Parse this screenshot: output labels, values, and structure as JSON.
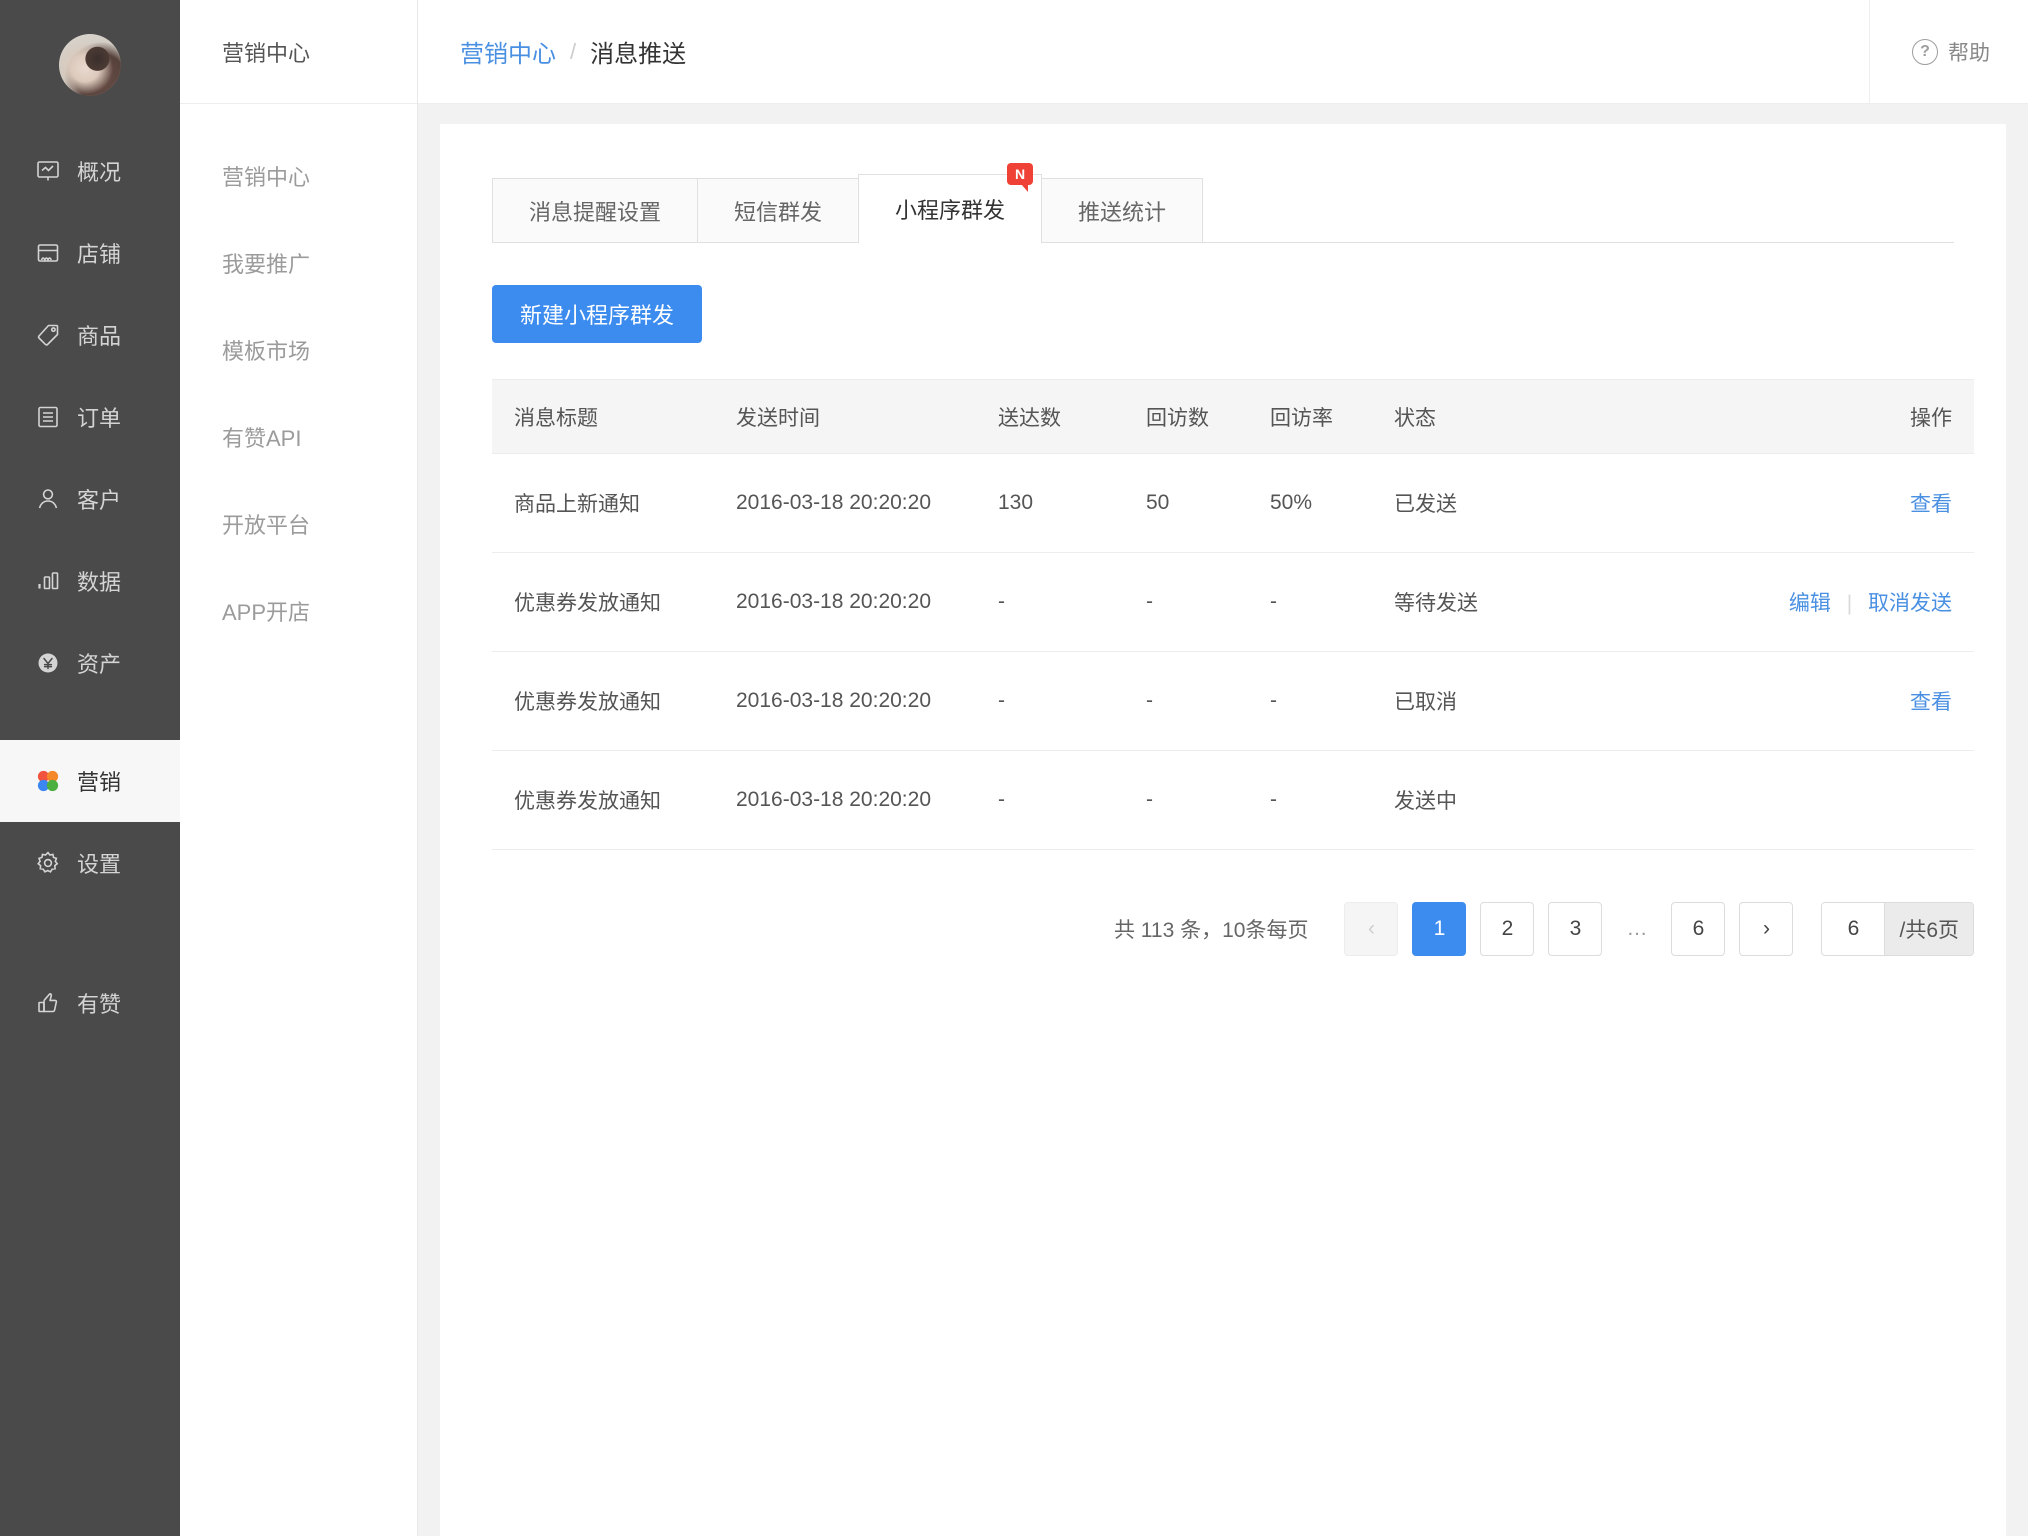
{
  "primary_nav": {
    "avatar_alt": "user-avatar",
    "items": [
      {
        "label": "概况",
        "icon": "overview-icon",
        "active": false
      },
      {
        "label": "店铺",
        "icon": "shop-icon",
        "active": false
      },
      {
        "label": "商品",
        "icon": "tag-icon",
        "active": false
      },
      {
        "label": "订单",
        "icon": "order-list-icon",
        "active": false
      },
      {
        "label": "客户",
        "icon": "user-icon",
        "active": false
      },
      {
        "label": "数据",
        "icon": "bar-chart-icon",
        "active": false
      },
      {
        "label": "资产",
        "icon": "yuan-coin-icon",
        "active": false
      },
      {
        "label": "营销",
        "icon": "marketing-flower-icon",
        "active": true
      },
      {
        "label": "设置",
        "icon": "gear-icon",
        "active": false
      },
      {
        "label": "有赞",
        "icon": "thumbs-up-icon",
        "active": false
      }
    ]
  },
  "secondary_nav": {
    "title": "营销中心",
    "items": [
      {
        "label": "营销中心"
      },
      {
        "label": "我要推广"
      },
      {
        "label": "模板市场"
      },
      {
        "label": "有赞API"
      },
      {
        "label": "开放平台"
      },
      {
        "label": "APP开店"
      }
    ]
  },
  "topbar": {
    "breadcrumb_parent": "营销中心",
    "breadcrumb_sep": "/",
    "breadcrumb_current": "消息推送",
    "help_label": "帮助",
    "help_icon": "question-circle-icon"
  },
  "tabs": [
    {
      "label": "消息提醒设置",
      "active": false,
      "badge": ""
    },
    {
      "label": "短信群发",
      "active": false,
      "badge": ""
    },
    {
      "label": "小程序群发",
      "active": true,
      "badge": "N"
    },
    {
      "label": "推送统计",
      "active": false,
      "badge": ""
    }
  ],
  "toolbar": {
    "create_label": "新建小程序群发"
  },
  "table": {
    "columns": [
      "消息标题",
      "发送时间",
      "送达数",
      "回访数",
      "回访率",
      "状态",
      "操作"
    ],
    "rows": [
      {
        "title": "商品上新通知",
        "send_time": "2016-03-18 20:20:20",
        "delivered": "130",
        "revisits": "50",
        "revisit_rate": "50%",
        "status": "已发送",
        "actions": [
          "查看"
        ]
      },
      {
        "title": "优惠券发放通知",
        "send_time": "2016-03-18 20:20:20",
        "delivered": "-",
        "revisits": "-",
        "revisit_rate": "-",
        "status": "等待发送",
        "actions": [
          "编辑",
          "取消发送"
        ]
      },
      {
        "title": "优惠券发放通知",
        "send_time": "2016-03-18 20:20:20",
        "delivered": "-",
        "revisits": "-",
        "revisit_rate": "-",
        "status": "已取消",
        "actions": [
          "查看"
        ]
      },
      {
        "title": "优惠券发放通知",
        "send_time": "2016-03-18 20:20:20",
        "delivered": "-",
        "revisits": "-",
        "revisit_rate": "-",
        "status": "发送中",
        "actions": []
      }
    ]
  },
  "pagination": {
    "summary": "共 113 条，10条每页",
    "prev_icon": "‹",
    "next_icon": "›",
    "pages": [
      "1",
      "2",
      "3",
      "…",
      "6"
    ],
    "active_page": "1",
    "jump_value": "6",
    "jump_suffix": "/共6页"
  },
  "colors": {
    "accent": "#3c8cf0",
    "link": "#4a90e2",
    "badge": "#ef4136",
    "sidebar_bg": "#4a4a4a",
    "content_bg": "#f2f2f2"
  }
}
